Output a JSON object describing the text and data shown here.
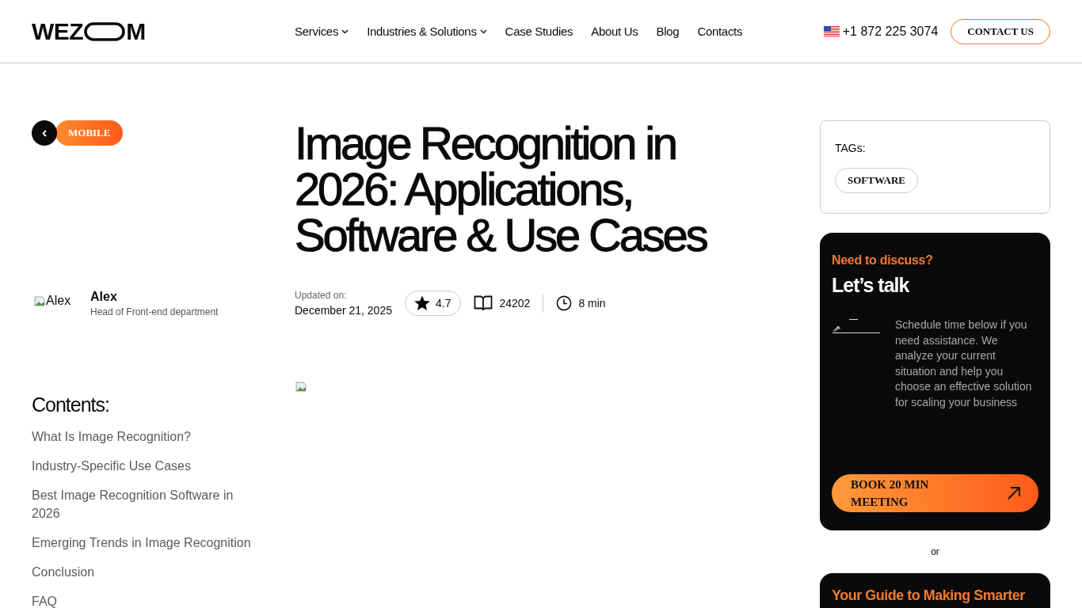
{
  "header": {
    "logo": {
      "left": "WEZ",
      "right": "M"
    },
    "nav": [
      {
        "label": "Services",
        "has_menu": true
      },
      {
        "label": "Industries & Solutions",
        "has_menu": true
      },
      {
        "label": "Case Studies",
        "has_menu": false
      },
      {
        "label": "About Us",
        "has_menu": false
      },
      {
        "label": "Blog",
        "has_menu": false
      },
      {
        "label": "Contacts",
        "has_menu": false
      }
    ],
    "phone": "+1 872 225 3074",
    "contact_button": "CONTACT US"
  },
  "category": "MOBILE",
  "author": {
    "photo_alt": "Alex",
    "name": "Alex",
    "role": "Head of Front-end department"
  },
  "contents": {
    "title": "Contents:",
    "items": [
      "What Is Image Recognition?",
      "Industry-Specific Use Cases",
      "Best Image Recognition Software in 2026",
      "Emerging Trends in Image Recognition",
      "Conclusion",
      "FAQ"
    ]
  },
  "article": {
    "title": "Image Recognition in 2026: Applications, Software & Use Cases",
    "updated_label": "Updated on:",
    "updated_date": "December 21, 2025",
    "rating": "4.7",
    "views": "24202",
    "read_time": "8 min"
  },
  "tags": {
    "title": "TAGs:",
    "items": [
      "SOFTWARE"
    ]
  },
  "talk_card": {
    "kicker": "Need to discuss?",
    "title": "Let’s talk",
    "text": "Schedule time below if you need assistance. We analyze your current situation and help you choose an effective solution for scaling your business",
    "button": "BOOK 20 MIN MEETING"
  },
  "or": "or",
  "guide_card": {
    "title": "Your Guide to Making Smarter"
  }
}
